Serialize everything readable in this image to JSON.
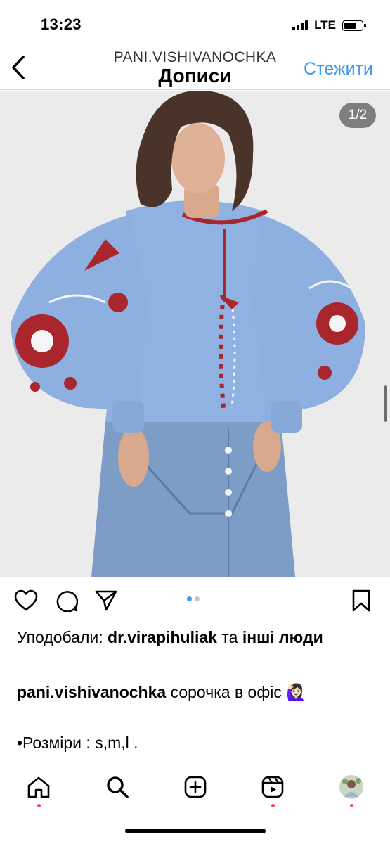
{
  "status": {
    "time": "13:23",
    "network": "LTE"
  },
  "nav": {
    "username": "PANI.VISHIVANOCHKA",
    "title": "Дописи",
    "follow": "Стежити"
  },
  "image": {
    "counter": "1/2"
  },
  "likes": {
    "prefix": "Уподобали: ",
    "user": "dr.virapihuliak",
    "middle": " та ",
    "others": "інші люди"
  },
  "caption": {
    "user": "pani.vishivanochka",
    "text": " сорочка в офіс 🙋🏻‍♀️"
  },
  "sizes": "•Розміри : s,m,l .",
  "icons": [
    "heart-icon",
    "comment-icon",
    "share-icon",
    "bookmark-icon",
    "home-icon",
    "search-icon",
    "new-post-icon",
    "reels-icon",
    "profile-avatar"
  ],
  "colors": {
    "accent": "#3897f0",
    "notification": "#ed4956"
  }
}
